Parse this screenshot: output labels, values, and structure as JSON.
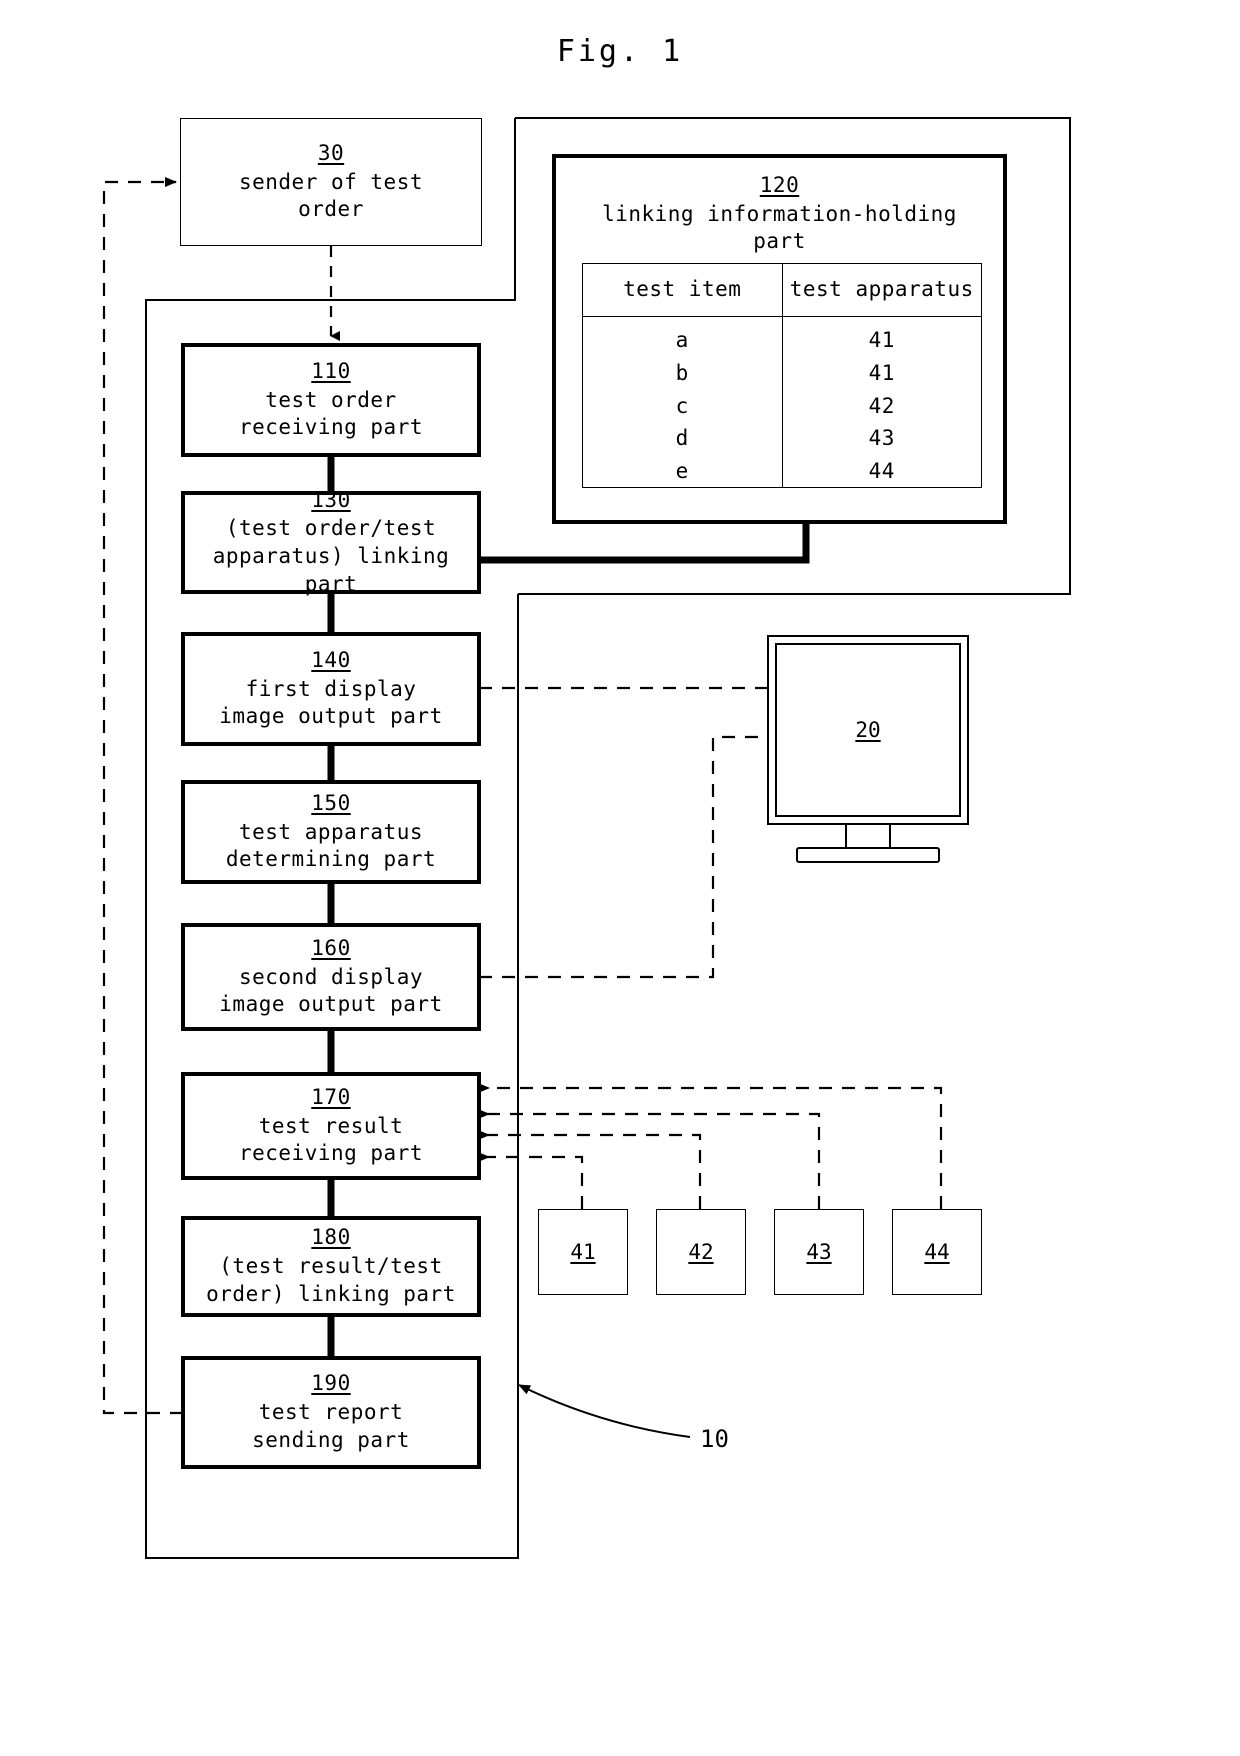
{
  "figure": {
    "title": "Fig. 1",
    "system_ref": "10"
  },
  "boxes": {
    "sender": {
      "ref": "30",
      "label": "sender of test\norder"
    },
    "receiver": {
      "ref": "110",
      "label": "test order\nreceiving part"
    },
    "linking": {
      "ref": "130",
      "label": "(test order/test\napparatus) linking\npart"
    },
    "first_display": {
      "ref": "140",
      "label": "first display\nimage output part"
    },
    "determining": {
      "ref": "150",
      "label": "test apparatus\ndetermining part"
    },
    "second_display": {
      "ref": "160",
      "label": "second display\nimage output part"
    },
    "result_receiver": {
      "ref": "170",
      "label": "test result\nreceiving part"
    },
    "result_linking": {
      "ref": "180",
      "label": "(test result/test\norder) linking part"
    },
    "report_sender": {
      "ref": "190",
      "label": "test report\nsending part"
    },
    "holding": {
      "ref": "120",
      "label": "linking information-holding\npart"
    },
    "monitor": {
      "ref": "20"
    }
  },
  "apparatuses": [
    {
      "ref": "41"
    },
    {
      "ref": "42"
    },
    {
      "ref": "43"
    },
    {
      "ref": "44"
    }
  ],
  "linking_table": {
    "headers": [
      "test item",
      "test apparatus"
    ],
    "rows": [
      [
        "a",
        "41"
      ],
      [
        "b",
        "41"
      ],
      [
        "c",
        "42"
      ],
      [
        "d",
        "43"
      ],
      [
        "e",
        "44"
      ]
    ]
  },
  "colors": {
    "ink": "#000000",
    "paper": "#ffffff"
  }
}
